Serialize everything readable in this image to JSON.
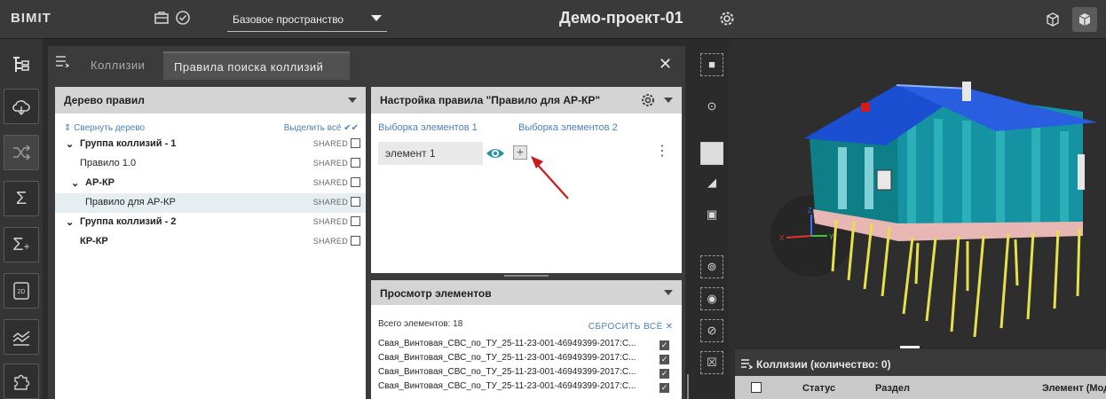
{
  "app": {
    "logo": "BIMIT",
    "space": "Базовое пространство",
    "project_title": "Демо-проект-01"
  },
  "topbar_icons": [
    "briefcase-icon",
    "check-circle-icon",
    "gear-icon"
  ],
  "sidebar": {
    "items": [
      "tree-icon",
      "cloud-icon",
      "shuffle-icon",
      "sigma-icon",
      "sigma-plus-icon",
      "2d-icon",
      "chart-icon",
      "puzzle-icon"
    ]
  },
  "panel": {
    "tabs": [
      {
        "label": "Коллизии"
      },
      {
        "label": "Правила поиска коллизий"
      }
    ]
  },
  "tree": {
    "title": "Дерево правил",
    "collapse_label": "Свернуть дерево",
    "select_all_label": "Выделить всё",
    "shared_label": "SHARED",
    "rows": [
      {
        "label": "Группа коллизий - 1"
      },
      {
        "label": "Правило 1.0"
      },
      {
        "label": "АР-КР"
      },
      {
        "label": "Правило для АР-КР"
      },
      {
        "label": "Группа коллизий - 2"
      },
      {
        "label": "КР-КР"
      }
    ]
  },
  "settings": {
    "title": "Настройка правила \"Правило для АР-КР\"",
    "tabs": [
      {
        "label": "Выборка элементов 1"
      },
      {
        "label": "Выборка элементов 2"
      }
    ],
    "element_chip": "элемент 1",
    "plus_label": "+"
  },
  "elements_view": {
    "title": "Просмотр элементов",
    "total_label": "Всего элементов: 18",
    "reset_label": "СБРОСИТЬ ВСЁ",
    "rows": [
      "Свая_Винтовая_СВС_по_ТУ_25-11-23-001-46949399-2017:С...",
      "Свая_Винтовая_СВС_по_ТУ_25-11-23-001-46949399-2017:С...",
      "Свая_Винтовая_СВС_по_ТУ_25-11-23-001-46949399-2017:С...",
      "Свая_Винтовая_СВС_по_ТУ_25-11-23-001-46949399-2017:С..."
    ]
  },
  "collisions_panel": {
    "title": "Коллизии (количество: 0)",
    "columns": [
      "Статус",
      "Раздел",
      "Элемент (Моде"
    ]
  },
  "colors": {
    "accent_blue": "#4a7fc1",
    "house_roof": "#1a4fd1",
    "house_wall": "#0e8a8a",
    "pile_yellow": "#e8e04a",
    "base_pink": "#e9b7b3"
  }
}
